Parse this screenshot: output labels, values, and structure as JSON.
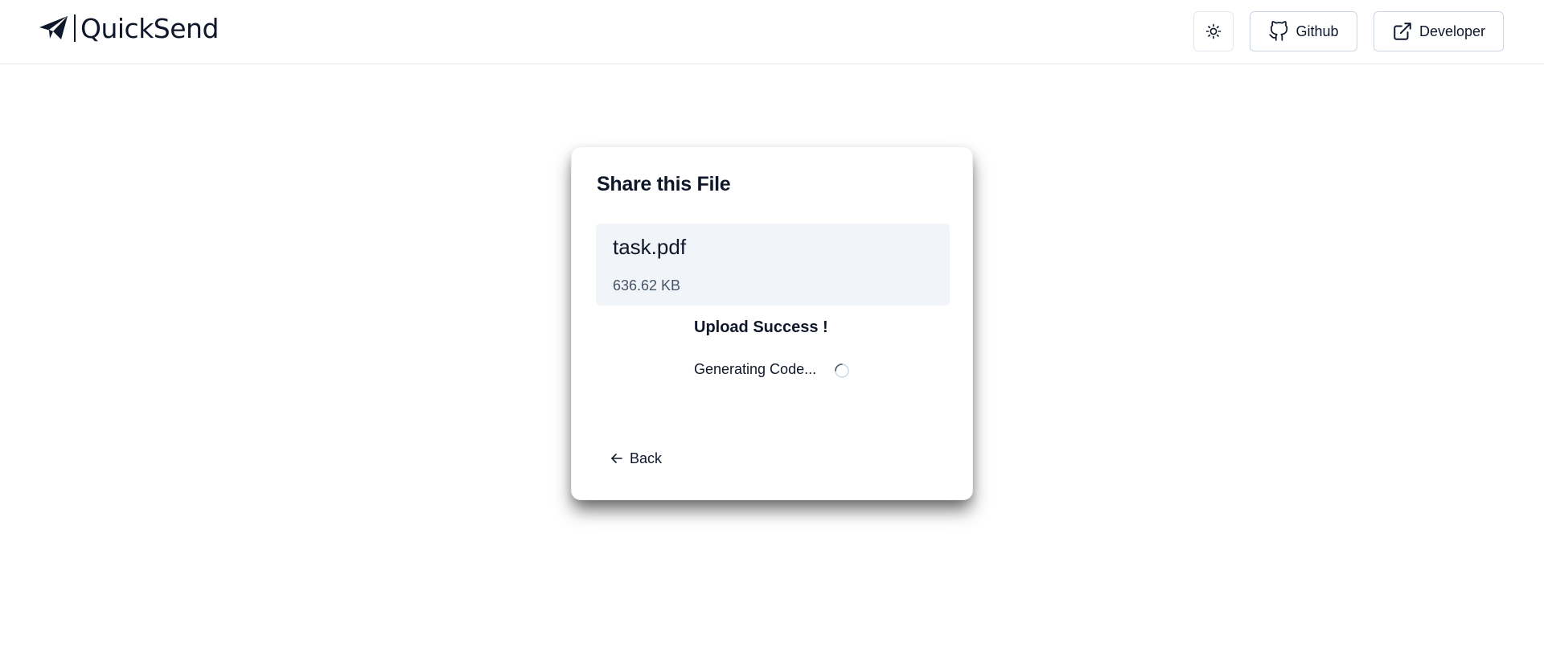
{
  "app": {
    "logo_text": "QuickSend"
  },
  "header": {
    "theme_toggle_icon": "sun-icon",
    "github_label": "Github",
    "github_icon": "github-icon",
    "developer_label": "Developer",
    "developer_icon": "external-link-icon"
  },
  "card": {
    "title": "Share this File",
    "file": {
      "name": "task.pdf",
      "size": "636.62 KB"
    },
    "status": {
      "title": "Upload Success !",
      "message": "Generating Code..."
    },
    "back_label": "Back"
  },
  "colors": {
    "text": "#0f172a",
    "muted_text": "#475569",
    "file_box_bg": "#f1f4f8",
    "border": "#cbd5e1"
  }
}
